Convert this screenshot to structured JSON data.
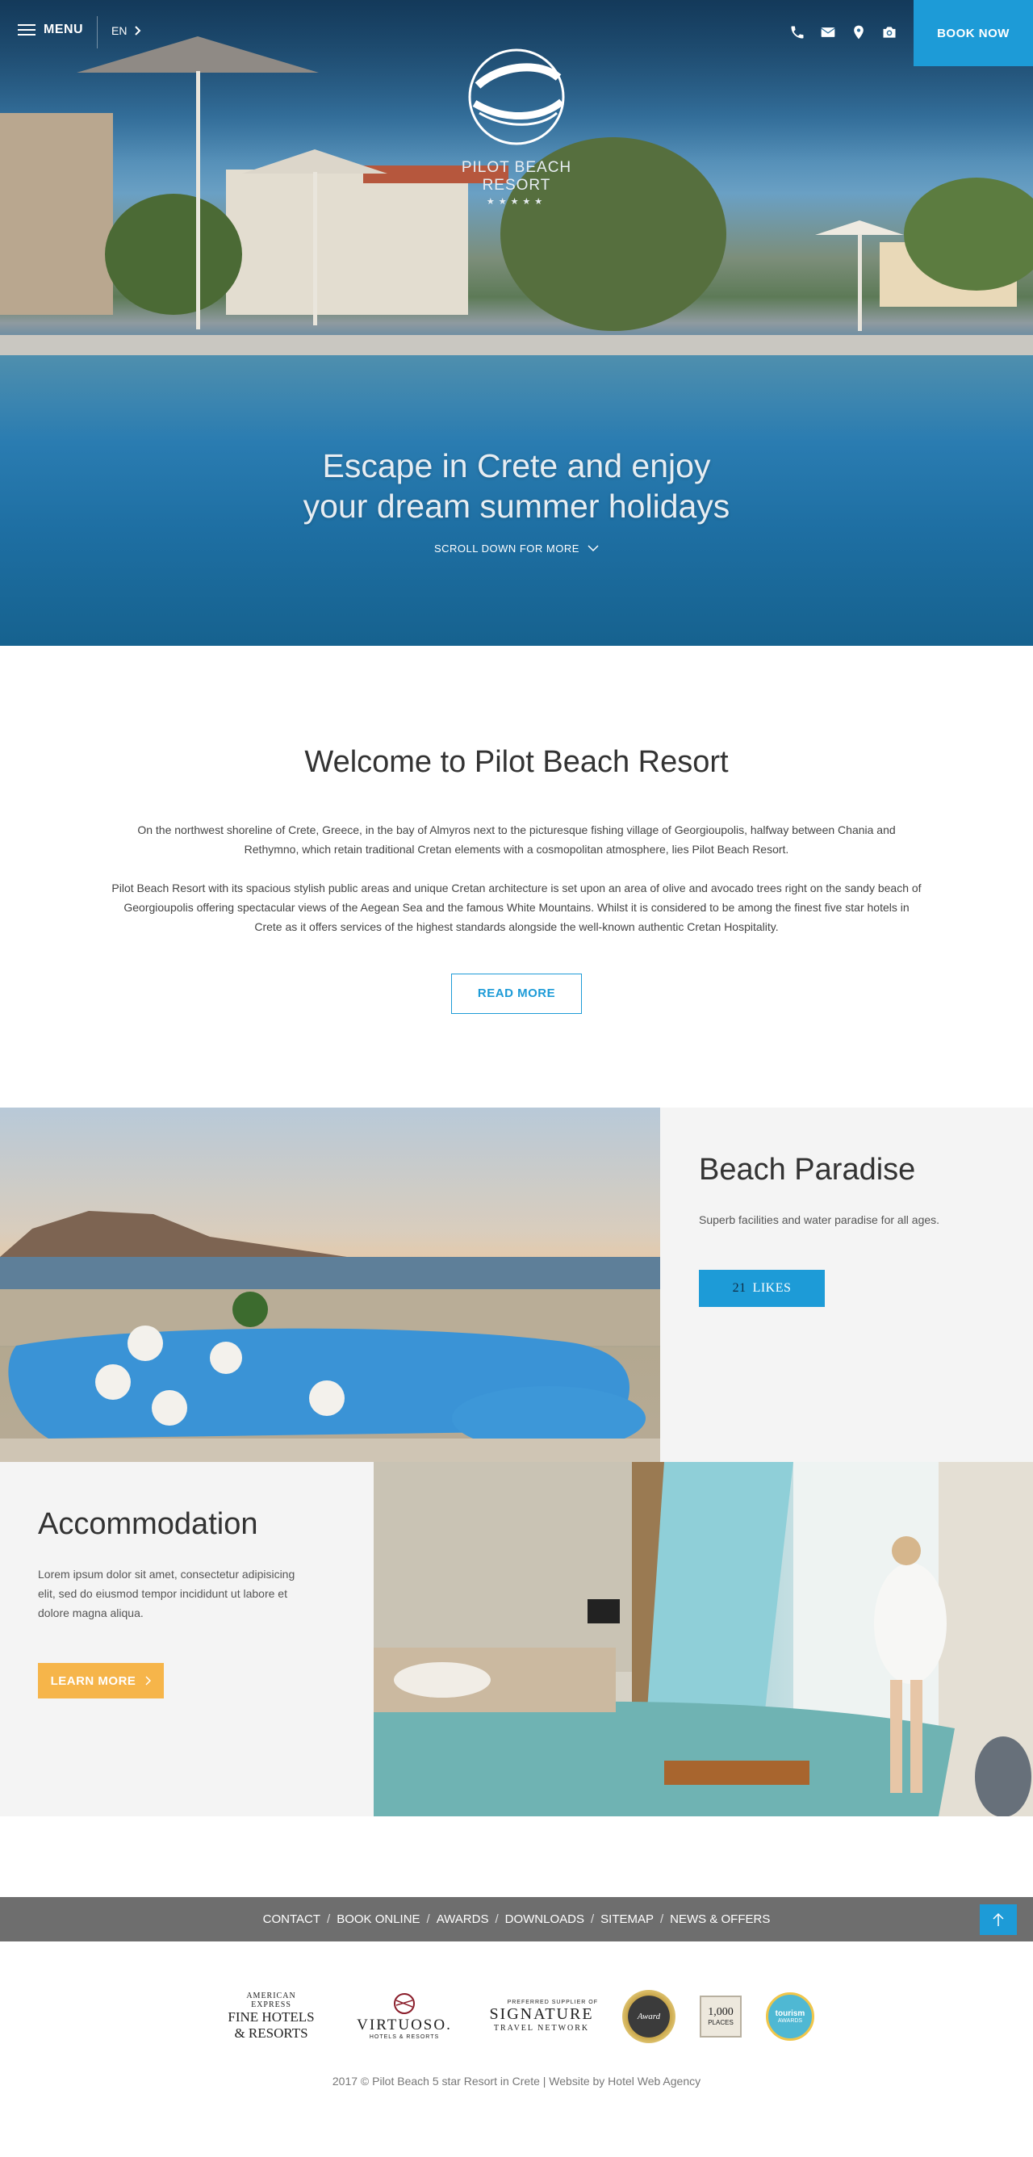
{
  "header": {
    "menu_label": "MENU",
    "language": "EN",
    "book_now": "BOOK NOW",
    "icons": [
      "phone-icon",
      "envelope-icon",
      "map-pin-icon",
      "camera-icon"
    ]
  },
  "logo": {
    "name": "PILOT BEACH RESORT",
    "stars": "★★★★★"
  },
  "hero": {
    "title_line1": "Escape in Crete and enjoy",
    "title_line2": "your dream summer holidays",
    "scroll_hint": "SCROLL DOWN FOR MORE"
  },
  "welcome": {
    "title": "Welcome to Pilot Beach Resort",
    "paragraph1": "On the northwest shoreline of Crete, Greece, in the bay of Almyros next to the picturesque fishing village of Georgioupolis, halfway between Chania and Rethymno, which retain traditional Cretan elements with a cosmopolitan atmosphere, lies Pilot Beach Resort.",
    "paragraph2": "Pilot Beach Resort with its spacious stylish public areas and unique Cretan architecture is set upon an area of olive and avocado trees right on the sandy beach of Georgioupolis offering spectacular views of the Aegean Sea and the famous White Mountains. Whilst it is considered to be among the finest five star hotels in Crete as it offers services of the highest standards alongside the well-known authentic Cretan Hospitality.",
    "read_more": "READ MORE"
  },
  "beach": {
    "title": "Beach Paradise",
    "text": "Superb facilities and water paradise for all ages.",
    "likes_count": "21",
    "likes_label": "LIKES"
  },
  "accommodation": {
    "title": "Accommodation",
    "text": "Lorem ipsum dolor sit amet, consectetur adipisicing elit, sed do eiusmod tempor incididunt ut labore et dolore magna aliqua.",
    "learn_more": "LEARN MORE"
  },
  "footer": {
    "links": [
      "CONTACT",
      "BOOK ONLINE",
      "AWARDS",
      "DOWNLOADS",
      "SITEMAP",
      "NEWS & OFFERS"
    ],
    "separator": "/",
    "partners": {
      "amex_line1": "AMERICAN",
      "amex_line2": "EXPRESS",
      "amex_line3": "FINE HOTELS",
      "amex_line4": "& RESORTS",
      "virtuoso_name": "VIRTUOSO.",
      "virtuoso_sub": "HOTELS & RESORTS",
      "signature_top": "PREFERRED SUPPLIER OF",
      "signature_name": "SIGNATURE",
      "signature_sub": "TRAVEL NETWORK",
      "award_text": "Award",
      "places_num": "1,000",
      "places_label": "PLACES",
      "tourism_label": "tourism",
      "tourism_sub": "AWARDS"
    },
    "copyright": "2017 © Pilot Beach 5 star Resort in Crete",
    "copyright_sep": "|",
    "agency": "Website by Hotel Web Agency"
  },
  "colors": {
    "accent_blue": "#1d9bd7",
    "accent_orange": "#f6b54a",
    "footer_gray": "#6e6e6e"
  }
}
